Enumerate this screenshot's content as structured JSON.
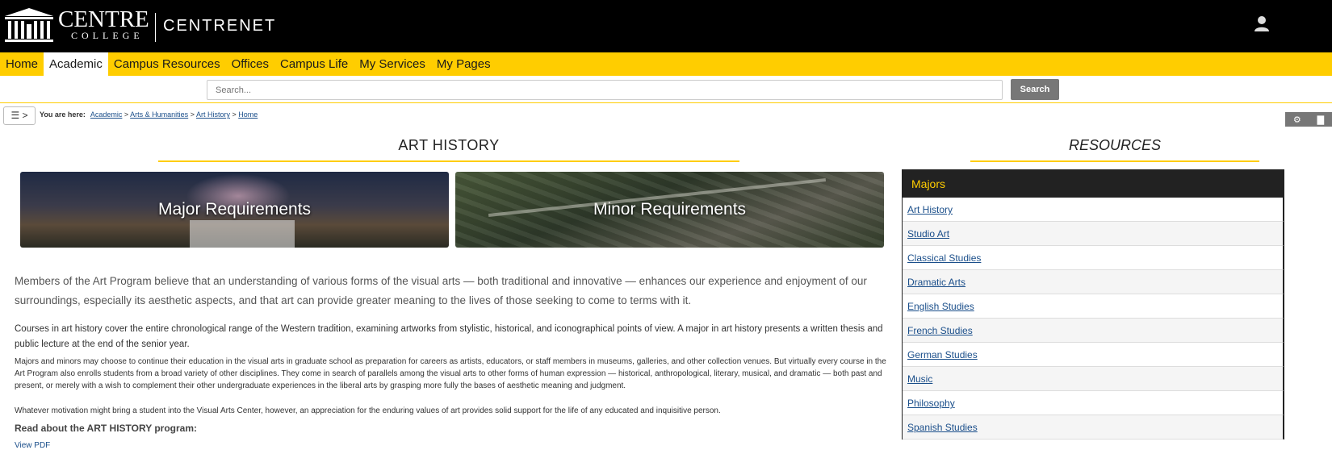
{
  "header": {
    "logo_line1": "CENTRE",
    "logo_line2": "COLLEGE",
    "site_name": "CENTRENET",
    "user_icon": "user-icon"
  },
  "nav": {
    "items": [
      "Home",
      "Academic",
      "Campus Resources",
      "Offices",
      "Campus Life",
      "My Services",
      "My Pages"
    ],
    "active": "Academic"
  },
  "search": {
    "placeholder": "Search...",
    "button_label": "Search"
  },
  "breadcrumb": {
    "menu_toggle": "☰ >",
    "prefix": "You are here:",
    "items": [
      "Academic",
      "Arts & Humanities",
      "Art History",
      "Home"
    ]
  },
  "tools": {
    "settings_icon": "gear-icon",
    "print_icon": "printer-icon"
  },
  "main": {
    "title": "ART HISTORY",
    "tiles": [
      "Major Requirements",
      "Minor Requirements"
    ],
    "intro": "Members of the Art Program believe that an understanding of various forms of the visual arts — both traditional and innovative — enhances our experience and enjoyment of our surroundings, especially its aesthetic aspects, and that art can provide greater meaning to the lives of those seeking to come to terms with it.",
    "p2": "Courses in art history cover the entire chronological range of the Western tradition, examining artworks from stylistic, historical, and iconographical points of view. A major in art history presents a written thesis and public lecture at the end of the senior year.",
    "p3": "Majors and minors may choose to continue their education in the visual arts in graduate school as preparation for careers as artists, educators, or staff members in museums, galleries, and other collection venues. But virtually every course in the Art Program also enrolls students from a broad variety of other disciplines. They come in search of parallels among the visual arts to other forms of human expression — historical, anthropological, literary, musical, and dramatic — both past and present, or merely with a wish to complement their other undergraduate experiences in the liberal arts by grasping more fully the bases of aesthetic meaning and judgment.",
    "p4": "Whatever motivation might bring a student into the Visual Arts Center, however, an appreciation for the enduring values of art provides solid support for the life of any educated and inquisitive person.",
    "read_about": "Read about the ART HISTORY program:",
    "view_pdf": "View PDF"
  },
  "resources": {
    "title": "RESOURCES",
    "box_heading": "Majors",
    "items": [
      "Art History",
      "Studio Art",
      "Classical Studies",
      "Dramatic Arts",
      "English Studies",
      "French Studies",
      "German Studies",
      "Music",
      "Philosophy",
      "Spanish Studies"
    ]
  }
}
